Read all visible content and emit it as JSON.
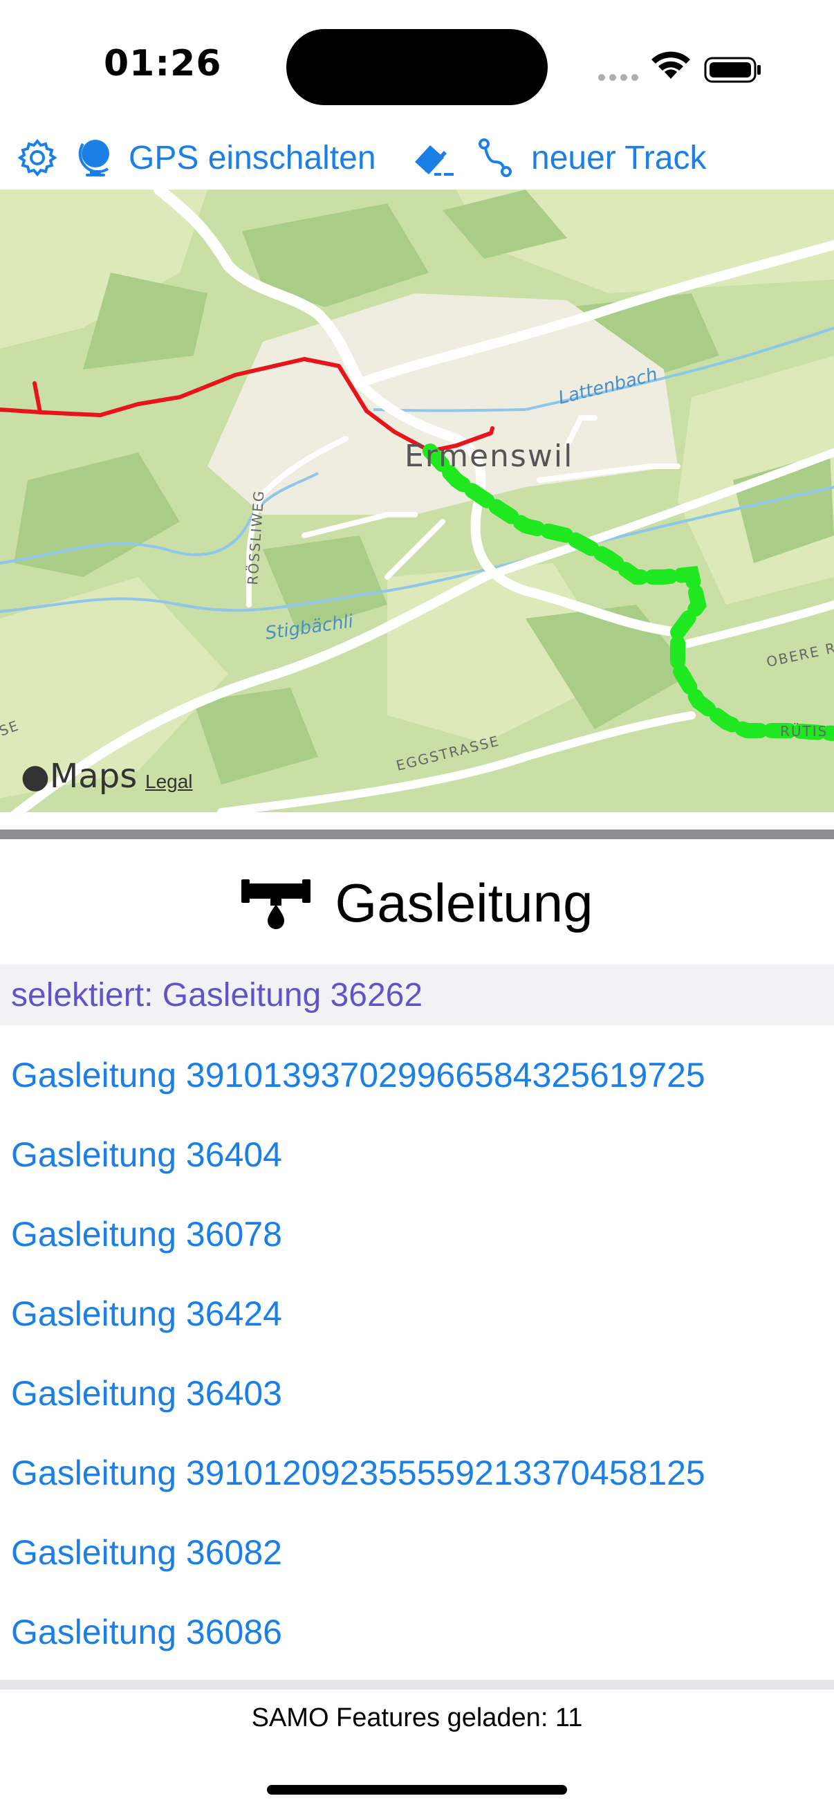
{
  "status_bar": {
    "time": "01:26"
  },
  "toolbar": {
    "gps_label": "GPS einschalten",
    "new_track_label": "neuer Track",
    "accent_color": "#1a7fe6"
  },
  "map": {
    "place_labels": {
      "town": "Ermenswil",
      "creek_top": "Lattenbach",
      "creek_bottom": "Stigbächli",
      "road_rossliweg": "RÖSSLIWEG",
      "road_egg": "EGGSTRASSE",
      "road_obere": "OBERE R",
      "road_rutis": "RÜTIS",
      "road_left": "SE"
    },
    "attribution": {
      "logo_text": "Maps",
      "legal": "Legal"
    },
    "colors": {
      "red_line": "#e8141c",
      "green_track": "#20e820"
    }
  },
  "layer": {
    "title": "Gasleitung"
  },
  "selection": {
    "text": "selektiert: Gasleitung 36262",
    "color": "#6153c9"
  },
  "features": [
    "Gasleitung 391013937029966584325619725",
    "Gasleitung 36404",
    "Gasleitung 36078",
    "Gasleitung 36424",
    "Gasleitung 36403",
    "Gasleitung 391012092355559213370458125",
    "Gasleitung 36082",
    "Gasleitung 36086"
  ],
  "footer": {
    "status": "SAMO Features geladen: 11"
  }
}
